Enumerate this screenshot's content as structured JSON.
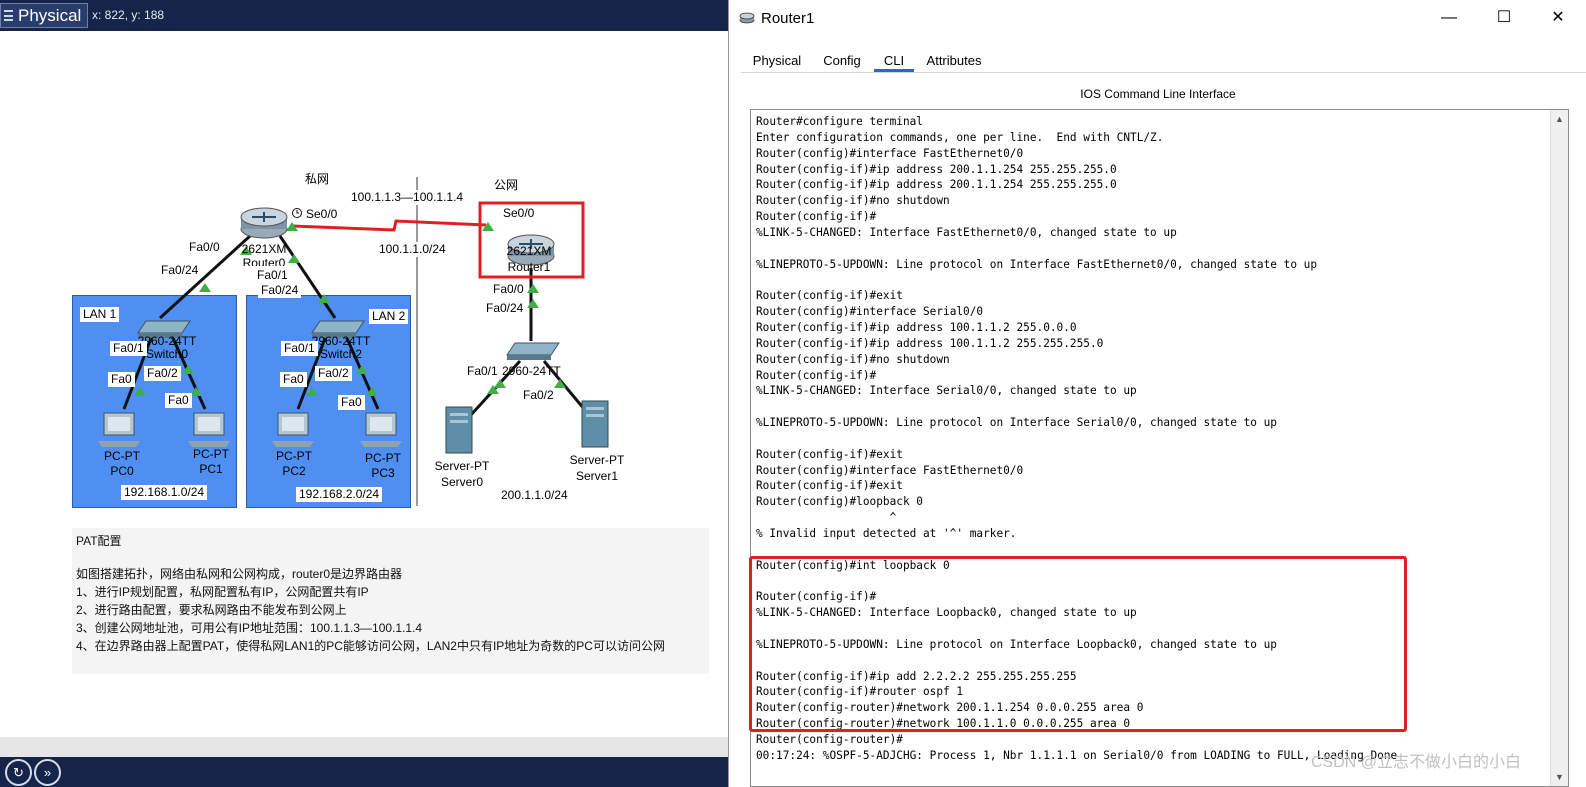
{
  "workspace": {
    "mode_tab": "Physical",
    "coords": "x: 822, y: 188",
    "region_private": "私网",
    "region_public": "公网",
    "pool_range": "100.1.1.3—100.1.1.4",
    "wan_net": "100.1.1.0/24",
    "router0": {
      "model": "2621XM",
      "name": "Router0",
      "serial": "Se0/0",
      "fa00": "Fa0/0",
      "fa01": "Fa0/1",
      "fa00_net": "Fa0/24",
      "fa01_net": "Fa0/24"
    },
    "router1": {
      "model": "2621XM",
      "name": "Router1",
      "serial": "Se0/0",
      "fa00": "Fa0/0",
      "fa00_net": "Fa0/24"
    },
    "lan1": {
      "name": "LAN 1",
      "switch": "2960-24TT Switch0",
      "sw_fa01": "Fa0/1",
      "sw_fa02": "Fa0/2",
      "pc0": {
        "type": "PC-PT",
        "name": "PC0",
        "port": "Fa0"
      },
      "pc1": {
        "type": "PC-PT",
        "name": "PC1",
        "port": "Fa0"
      },
      "subnet": "192.168.1.0/24"
    },
    "lan2": {
      "name": "LAN 2",
      "switch": "2960-24TT Switch2",
      "sw_fa01": "Fa0/1",
      "sw_fa02": "Fa0/2",
      "pc2": {
        "type": "PC-PT",
        "name": "PC2",
        "port": "Fa0"
      },
      "pc3": {
        "type": "PC-PT",
        "name": "PC3",
        "port": "Fa0"
      },
      "subnet": "192.168.2.0/24"
    },
    "public_lan": {
      "switch": "2960-24TT",
      "sw_fa01": "Fa0/1",
      "sw_fa02": "Fa0/2",
      "server0": {
        "type": "Server-PT",
        "name": "Server0"
      },
      "server1": {
        "type": "Server-PT",
        "name": "Server1"
      },
      "subnet": "200.1.1.0/24"
    },
    "note": {
      "title": "PAT配置",
      "lines": [
        "如图搭建拓扑，网络由私网和公网构成，router0是边界路由器",
        "1、进行IP规划配置，私网配置私有IP，公网配置共有IP",
        "2、进行路由配置，要求私网路由不能发布到公网上",
        "3、创建公网地址池，可用公有IP地址范围：100.1.1.3—100.1.1.4",
        "4、在边界路由器上配置PAT，使得私网LAN1的PC能够访问公网，LAN2中只有IP地址为奇数的PC可以访问公网"
      ]
    },
    "colors": {
      "lan_fill": "#4f8ff2",
      "link_up": "#3cb043",
      "highlight": "#e02020",
      "bar": "#15254a"
    }
  },
  "window": {
    "title": "Router1",
    "tabs": [
      "Physical",
      "Config",
      "CLI",
      "Attributes"
    ],
    "active_tab": "CLI",
    "cli_title": "IOS Command Line Interface",
    "terminal_lines": [
      "Router#configure terminal",
      "Enter configuration commands, one per line.  End with CNTL/Z.",
      "Router(config)#interface FastEthernet0/0",
      "Router(config-if)#ip address 200.1.1.254 255.255.255.0",
      "Router(config-if)#ip address 200.1.1.254 255.255.255.0",
      "Router(config-if)#no shutdown",
      "Router(config-if)#",
      "%LINK-5-CHANGED: Interface FastEthernet0/0, changed state to up",
      "",
      "%LINEPROTO-5-UPDOWN: Line protocol on Interface FastEthernet0/0, changed state to up",
      "",
      "Router(config-if)#exit",
      "Router(config)#interface Serial0/0",
      "Router(config-if)#ip address 100.1.1.2 255.0.0.0",
      "Router(config-if)#ip address 100.1.1.2 255.255.255.0",
      "Router(config-if)#no shutdown",
      "Router(config-if)#",
      "%LINK-5-CHANGED: Interface Serial0/0, changed state to up",
      "",
      "%LINEPROTO-5-UPDOWN: Line protocol on Interface Serial0/0, changed state to up",
      "",
      "Router(config-if)#exit",
      "Router(config)#interface FastEthernet0/0",
      "Router(config-if)#exit",
      "Router(config)#loopback 0",
      "                    ^",
      "% Invalid input detected at '^' marker.",
      "",
      "Router(config)#int loopback 0",
      "",
      "Router(config-if)#",
      "%LINK-5-CHANGED: Interface Loopback0, changed state to up",
      "",
      "%LINEPROTO-5-UPDOWN: Line protocol on Interface Loopback0, changed state to up",
      "",
      "Router(config-if)#ip add 2.2.2.2 255.255.255.255",
      "Router(config-if)#router ospf 1",
      "Router(config-router)#network 200.1.1.254 0.0.0.255 area 0",
      "Router(config-router)#network 100.1.1.0 0.0.0.255 area 0",
      "Router(config-router)#",
      "00:17:24: %OSPF-5-ADJCHG: Process 1, Nbr 1.1.1.1 on Serial0/0 from LOADING to FULL, Loading Done"
    ],
    "watermark": "CSDN @立志不做小白的小白"
  }
}
